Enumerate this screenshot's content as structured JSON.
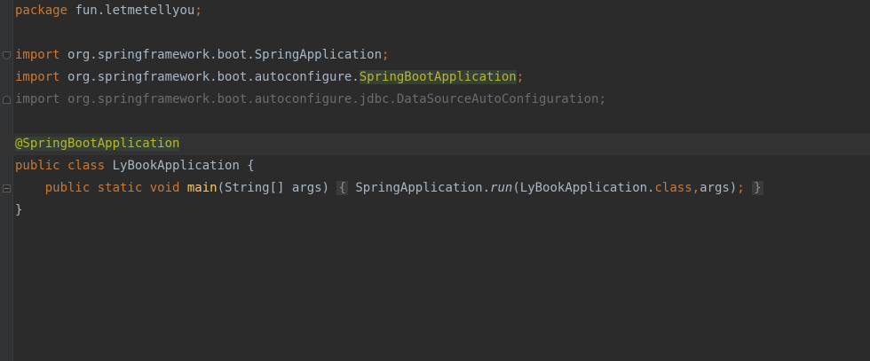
{
  "editor": {
    "lines": [
      {
        "parts": [
          {
            "t": "package",
            "c": "kw"
          },
          {
            "t": " fun.letmetellyou",
            "c": "plain"
          },
          {
            "t": ";",
            "c": "kw"
          }
        ]
      },
      {
        "parts": []
      },
      {
        "parts": [
          {
            "t": "import",
            "c": "kw"
          },
          {
            "t": " org.springframework.boot.SpringApplication",
            "c": "plain"
          },
          {
            "t": ";",
            "c": "kw"
          }
        ]
      },
      {
        "parts": [
          {
            "t": "import",
            "c": "kw"
          },
          {
            "t": " org.springframework.boot.autoconfigure.",
            "c": "plain"
          },
          {
            "t": "SpringBootApplication",
            "c": "name-hl"
          },
          {
            "t": ";",
            "c": "kw"
          }
        ]
      },
      {
        "parts": [
          {
            "t": "import org.springframework.boot.autoconfigure.jdbc.DataSourceAutoConfiguration;",
            "c": "unused"
          }
        ]
      },
      {
        "parts": []
      },
      {
        "parts": [
          {
            "t": "@SpringBootApplication",
            "c": "ann-hl"
          }
        ],
        "current": true
      },
      {
        "parts": [
          {
            "t": "public class",
            "c": "kw"
          },
          {
            "t": " LyBookApplication {",
            "c": "plain"
          }
        ]
      },
      {
        "parts": [
          {
            "t": "    public static void",
            "c": "kw"
          },
          {
            "t": " ",
            "c": "plain"
          },
          {
            "t": "main",
            "c": "fn"
          },
          {
            "t": "(String[] args) ",
            "c": "plain"
          },
          {
            "t": "{",
            "c": "brace-box"
          },
          {
            "t": " SpringApplication.",
            "c": "plain"
          },
          {
            "t": "run",
            "c": "plain italic"
          },
          {
            "t": "(LyBookApplication.",
            "c": "plain"
          },
          {
            "t": "class",
            "c": "kw"
          },
          {
            "t": ",",
            "c": "kw"
          },
          {
            "t": "args)",
            "c": "plain"
          },
          {
            "t": ";",
            "c": "kw"
          },
          {
            "t": " ",
            "c": "plain"
          },
          {
            "t": "}",
            "c": "brace-box"
          }
        ]
      },
      {
        "parts": [
          {
            "t": "}",
            "c": "plain"
          }
        ]
      }
    ],
    "fold_markers": [
      {
        "line": 2,
        "kind": "top"
      },
      {
        "line": 4,
        "kind": "bottom"
      },
      {
        "line": 8,
        "kind": "box"
      }
    ]
  }
}
